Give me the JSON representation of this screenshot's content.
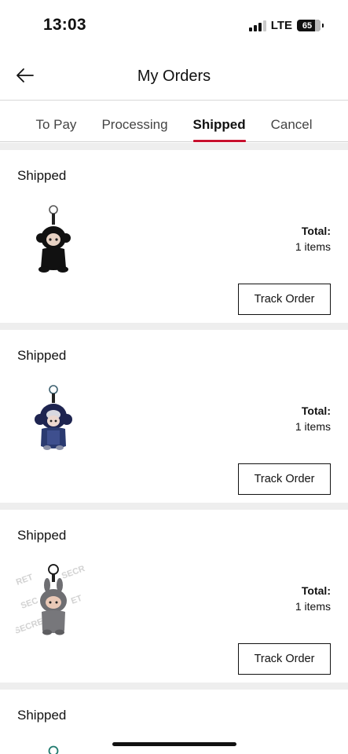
{
  "status_bar": {
    "time": "13:03",
    "network": "LTE",
    "battery": "65"
  },
  "header": {
    "title": "My Orders",
    "back_icon": "arrow-left-icon"
  },
  "tabs": [
    {
      "label": "To Pay",
      "active": false
    },
    {
      "label": "Processing",
      "active": false
    },
    {
      "label": "Shipped",
      "active": true
    },
    {
      "label": "Cancel",
      "active": false
    }
  ],
  "orders": [
    {
      "status": "Shipped",
      "total_label": "Total:",
      "items": "1 items",
      "track_label": "Track Order",
      "product_icon": "black-plush-keychain"
    },
    {
      "status": "Shipped",
      "total_label": "Total:",
      "items": "1 items",
      "track_label": "Track Order",
      "product_icon": "navy-plush-keychain"
    },
    {
      "status": "Shipped",
      "total_label": "Total:",
      "items": "1 items",
      "track_label": "Track Order",
      "product_icon": "grey-bunny-plush-keychain-secret"
    },
    {
      "status": "Shipped"
    }
  ],
  "colors": {
    "accent": "#c8102e",
    "divider": "#eeeeee"
  }
}
